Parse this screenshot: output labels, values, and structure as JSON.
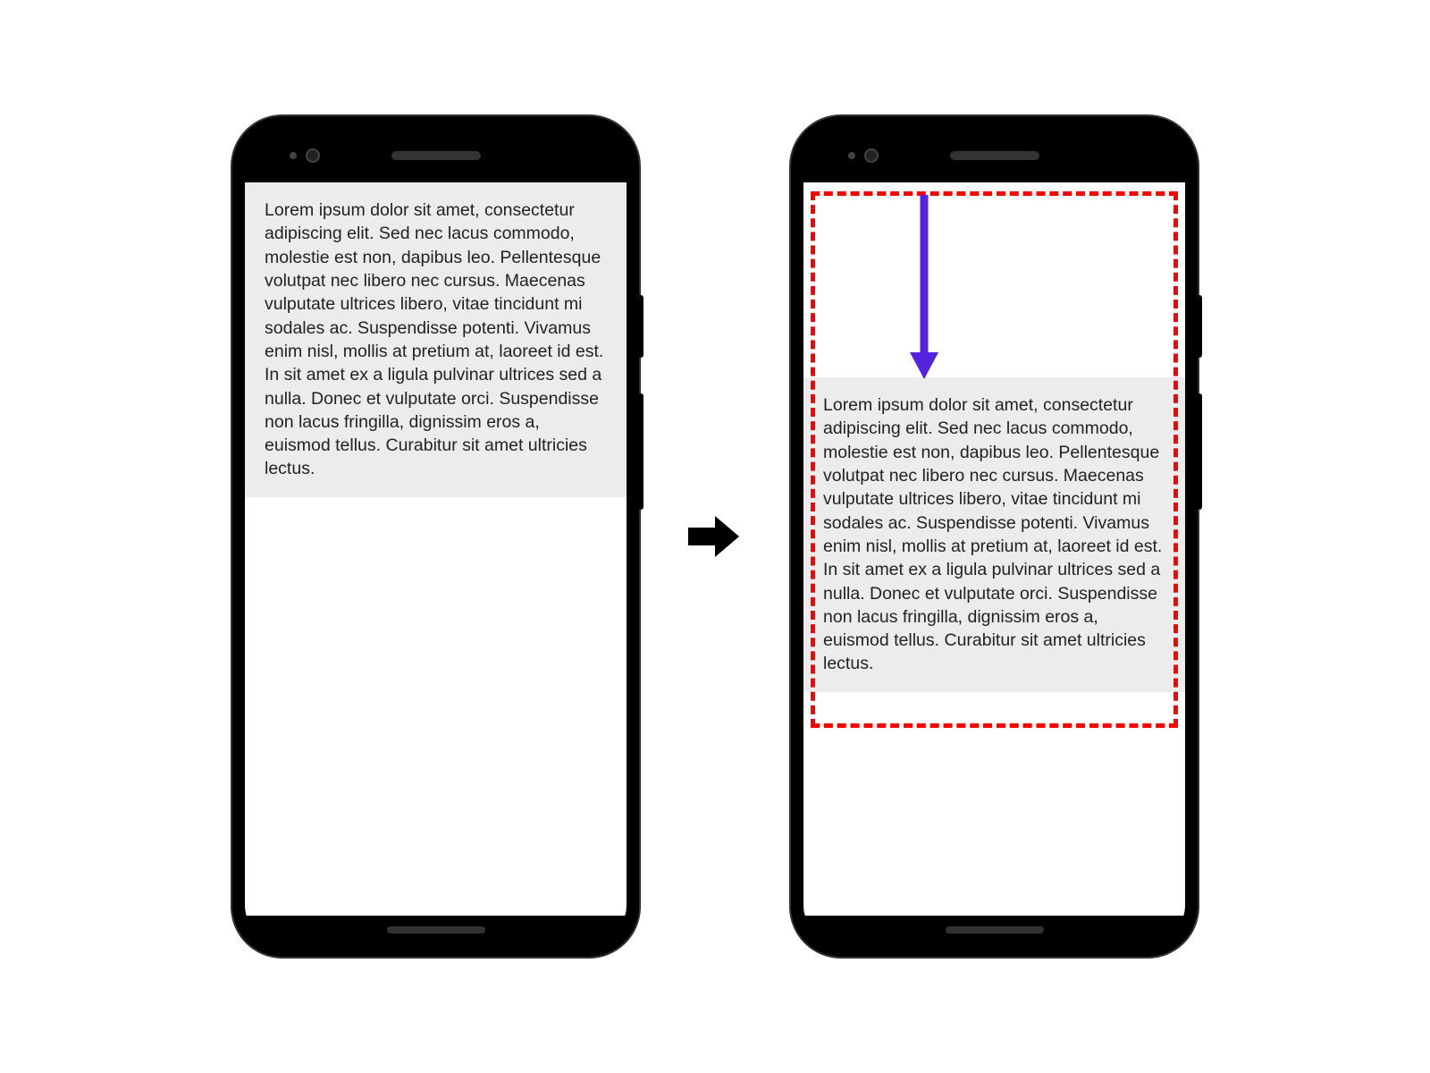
{
  "content": {
    "lorem_text": "Lorem ipsum dolor sit amet, consectetur adipiscing elit. Sed nec lacus commodo, molestie est non, dapibus leo. Pellentesque volutpat nec libero nec cursus. Maecenas vulputate ultrices libero, vitae tincidunt mi sodales ac. Suspendisse potenti. Vivamus enim nisl, mollis at pretium at, laoreet id est. In sit amet ex a ligula pulvinar ultrices sed a nulla. Donec et vulputate orci. Suspendisse non lacus fringilla, dignissim eros a, euismod tellus. Curabitur sit amet ultricies lectus."
  },
  "colors": {
    "dashed_border": "#ff0000",
    "arrow": "#5522dd",
    "text_bg": "#ececec"
  }
}
